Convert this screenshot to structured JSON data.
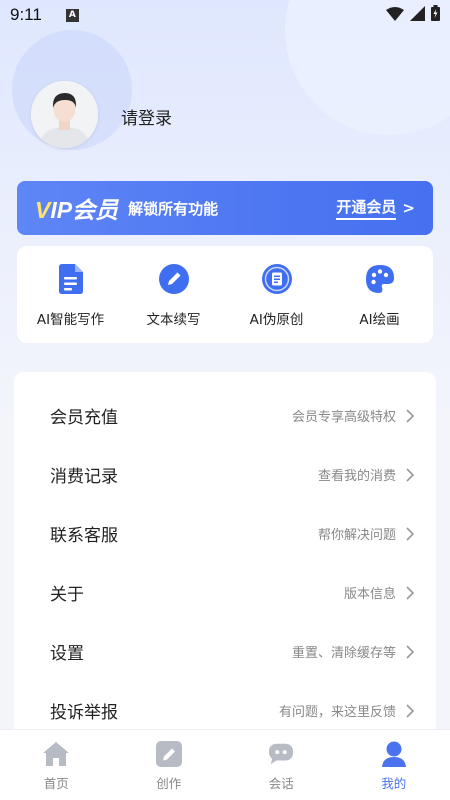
{
  "status_bar": {
    "time": "9:11",
    "indicator": "A",
    "icons": [
      "wifi-icon",
      "signal-icon",
      "battery-icon"
    ]
  },
  "profile": {
    "login_label": "请登录"
  },
  "vip_banner": {
    "title_v": "V",
    "title_rest": "IP会员",
    "subtitle": "解锁所有功能",
    "cta": "开通会员",
    "cta_arrow": ">"
  },
  "tools": [
    {
      "label": "AI智能写作",
      "icon": "document-icon"
    },
    {
      "label": "文本续写",
      "icon": "pencil-icon"
    },
    {
      "label": "AI伪原创",
      "icon": "article-icon"
    },
    {
      "label": "AI绘画",
      "icon": "palette-icon"
    }
  ],
  "menu": [
    {
      "label": "会员充值",
      "hint": "会员专享高级特权"
    },
    {
      "label": "消费记录",
      "hint": "查看我的消费"
    },
    {
      "label": "联系客服",
      "hint": "帮你解决问题"
    },
    {
      "label": "关于",
      "hint": "版本信息"
    },
    {
      "label": "设置",
      "hint": "重置、清除缓存等"
    },
    {
      "label": "投诉举报",
      "hint": "有问题，来这里反馈"
    }
  ],
  "nav": [
    {
      "label": "首页",
      "icon": "home-icon",
      "active": false
    },
    {
      "label": "创作",
      "icon": "edit-icon",
      "active": false
    },
    {
      "label": "会话",
      "icon": "chat-icon",
      "active": false
    },
    {
      "label": "我的",
      "icon": "user-icon",
      "active": true
    }
  ],
  "colors": {
    "accent": "#4b73ef",
    "vip_gold": "#ffe36b",
    "background": "#f3f5fb"
  }
}
